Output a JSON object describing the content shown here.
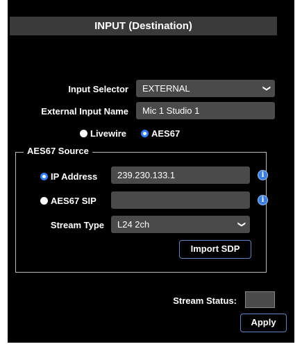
{
  "title": "INPUT (Destination)",
  "input_selector": {
    "label": "Input Selector",
    "value": "EXTERNAL"
  },
  "external_input_name": {
    "label": "External Input Name",
    "value": "Mic 1 Studio 1"
  },
  "mode": {
    "livewire_label": "Livewire",
    "aes67_label": "AES67",
    "selected": "AES67"
  },
  "aes67_source": {
    "legend": "AES67 Source",
    "ip_address": {
      "label": "IP Address",
      "value": "239.230.133.1",
      "selected": true
    },
    "aes67_sip": {
      "label": "AES67 SIP",
      "value": "",
      "selected": false
    },
    "stream_type": {
      "label": "Stream Type",
      "value": "L24 2ch"
    },
    "import_sdp_label": "Import SDP"
  },
  "stream_status": {
    "label": "Stream Status:"
  },
  "apply_label": "Apply",
  "colors": {
    "accent": "#2f7df6",
    "field_bg": "#4a4a4a",
    "title_bg": "#3a3a3a"
  },
  "icons": {
    "info": "info-icon",
    "dropdown": "chevron-down-icon"
  }
}
